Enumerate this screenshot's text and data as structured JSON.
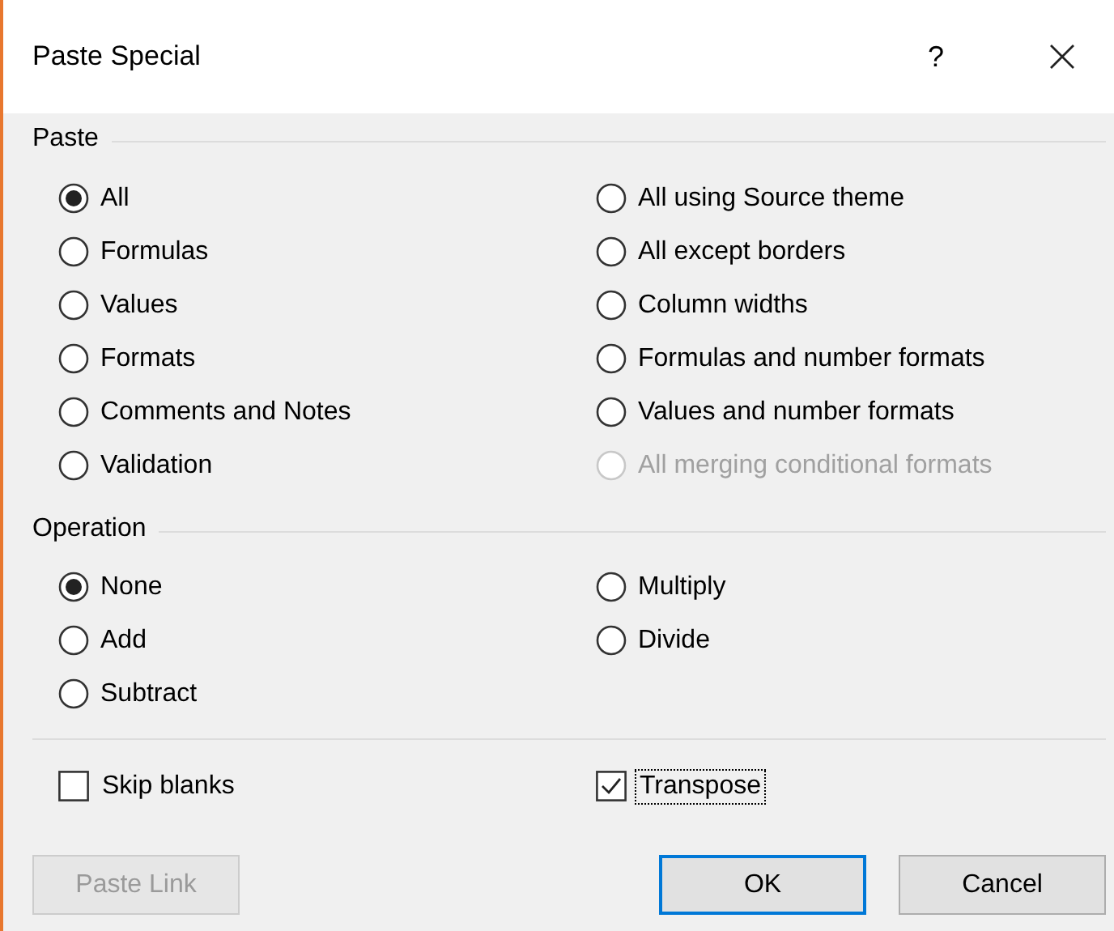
{
  "window": {
    "title": "Paste Special",
    "help": "?"
  },
  "paste": {
    "label": "Paste",
    "left": [
      {
        "label": "All",
        "selected": true,
        "disabled": false
      },
      {
        "label": "Formulas",
        "selected": false,
        "disabled": false
      },
      {
        "label": "Values",
        "selected": false,
        "disabled": false
      },
      {
        "label": "Formats",
        "selected": false,
        "disabled": false
      },
      {
        "label": "Comments and Notes",
        "selected": false,
        "disabled": false
      },
      {
        "label": "Validation",
        "selected": false,
        "disabled": false
      }
    ],
    "right": [
      {
        "label": "All using Source theme",
        "selected": false,
        "disabled": false
      },
      {
        "label": "All except borders",
        "selected": false,
        "disabled": false
      },
      {
        "label": "Column widths",
        "selected": false,
        "disabled": false
      },
      {
        "label": "Formulas and number formats",
        "selected": false,
        "disabled": false
      },
      {
        "label": "Values and number formats",
        "selected": false,
        "disabled": false
      },
      {
        "label": "All merging conditional formats",
        "selected": false,
        "disabled": true
      }
    ]
  },
  "operation": {
    "label": "Operation",
    "left": [
      {
        "label": "None",
        "selected": true,
        "disabled": false
      },
      {
        "label": "Add",
        "selected": false,
        "disabled": false
      },
      {
        "label": "Subtract",
        "selected": false,
        "disabled": false
      }
    ],
    "right": [
      {
        "label": "Multiply",
        "selected": false,
        "disabled": false
      },
      {
        "label": "Divide",
        "selected": false,
        "disabled": false
      }
    ]
  },
  "checkboxes": [
    {
      "label": "Skip blanks",
      "checked": false,
      "focused": false
    },
    {
      "label": "Transpose",
      "checked": true,
      "focused": true
    }
  ],
  "buttons": [
    {
      "label": "Paste Link",
      "kind": "secondary",
      "disabled": true
    },
    {
      "label": "OK",
      "kind": "default",
      "disabled": false
    },
    {
      "label": "Cancel",
      "kind": "secondary",
      "disabled": false
    }
  ]
}
